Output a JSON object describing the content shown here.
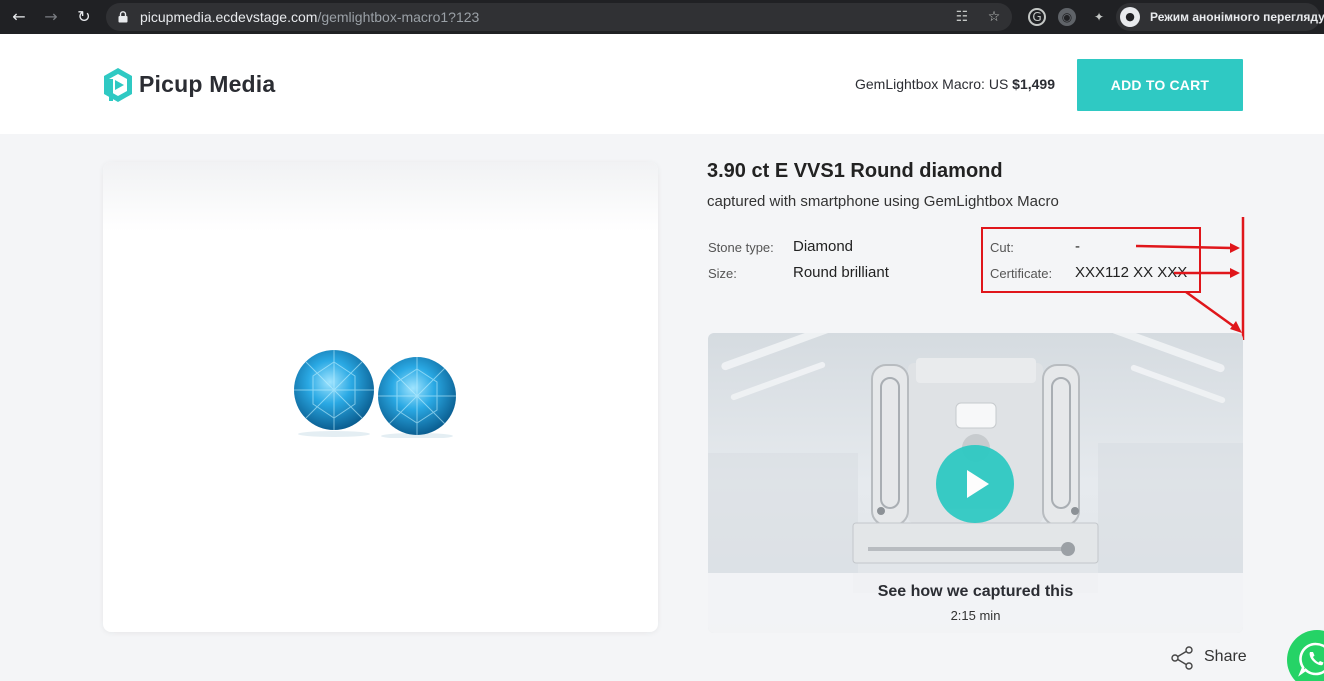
{
  "browser": {
    "url_domain": "picupmedia.ecdevstage.com",
    "url_path": "/gemlightbox-macro1?123",
    "incognito_label": "Режим анонімного перегляду"
  },
  "header": {
    "logo_text": "Picup Media",
    "product_name": "GemLightbox Macro: US ",
    "product_price": "$1,499",
    "cart_label": "ADD TO CART",
    "accent_color": "#2fc9c3"
  },
  "product": {
    "title": "3.90 ct E VVS1 Round diamond",
    "subtitle": "captured with smartphone using GemLightbox Macro",
    "specs_left": [
      {
        "label": "Stone type:",
        "value": "Diamond"
      },
      {
        "label": "Size:",
        "value": "Round brilliant"
      }
    ],
    "specs_right": [
      {
        "label": "Cut:",
        "value": "-"
      },
      {
        "label": "Certificate:",
        "value": "XXX112 XX XXX"
      }
    ]
  },
  "video": {
    "title": "See how we captured this",
    "duration": "2:15 min"
  },
  "share_label": "Share",
  "annotation_color": "#e0161b"
}
